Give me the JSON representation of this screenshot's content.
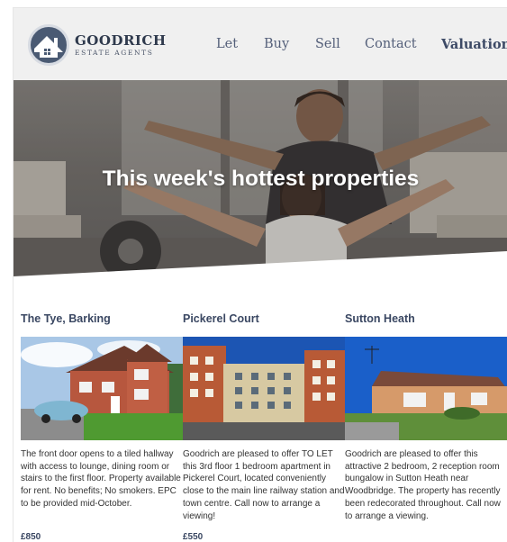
{
  "brand": {
    "name": "GOODRICH",
    "tagline": "ESTATE AGENTS",
    "logo_icon": "house-icon",
    "color_primary": "#4a5a73"
  },
  "nav": {
    "items": [
      {
        "label": "Let"
      },
      {
        "label": "Buy"
      },
      {
        "label": "Sell"
      },
      {
        "label": "Contact"
      },
      {
        "label": "Valuation"
      }
    ],
    "active": "Valuation"
  },
  "hero": {
    "title": "This week's hottest properties"
  },
  "listings": [
    {
      "title": "The Tye, Barking",
      "description": "The front door opens to a tiled hallway with access to lounge, dining room or stairs to the first floor. Property available for rent. No benefits; No smokers. EPC to be provided mid-October.",
      "price": "£850"
    },
    {
      "title": "Pickerel Court",
      "description": "Goodrich are pleased to offer TO LET this 3rd floor 1 bedroom apartment in Pickerel Court, located conveniently close to the main line railway station and town centre. Call now to arrange a viewing!",
      "price": "£550"
    },
    {
      "title": "Sutton Heath",
      "description": "Goodrich are pleased to offer this attractive 2 bedroom, 2 reception room bungalow in Sutton Heath near Woodbridge. The property has recently been redecorated throughout. Call now to arrange a viewing.",
      "price": ""
    }
  ]
}
